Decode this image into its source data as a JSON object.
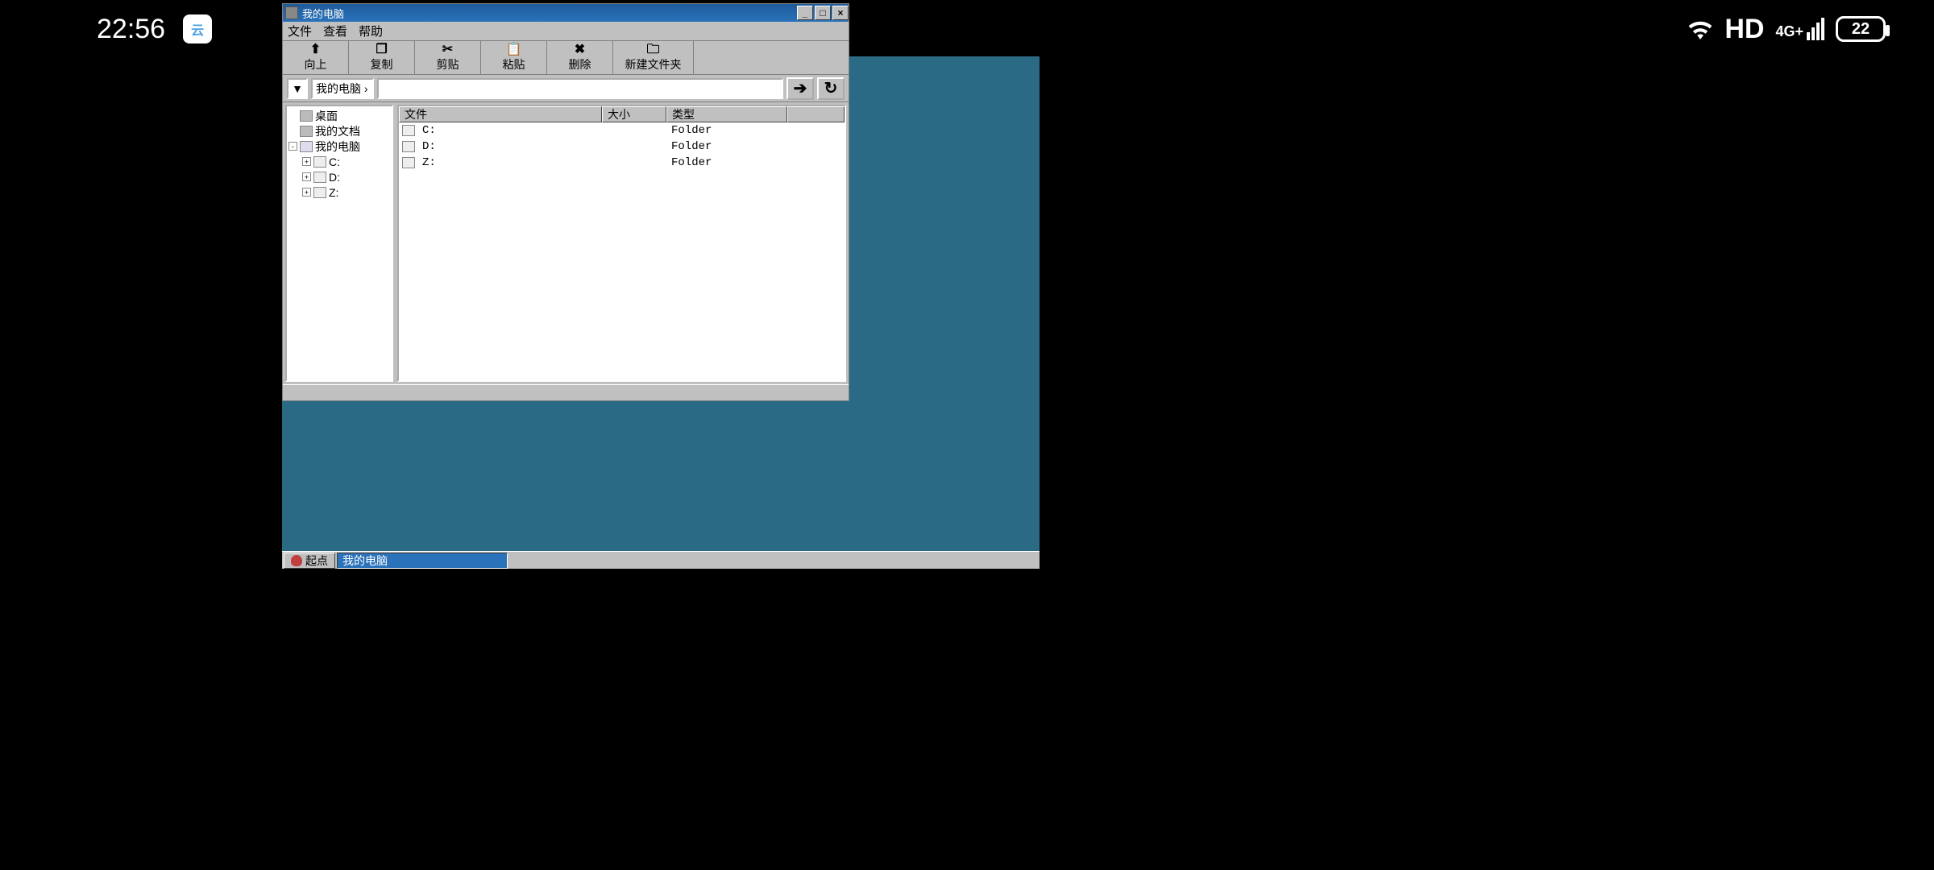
{
  "status": {
    "clock": "22:56",
    "app_badge": "云",
    "hd": "HD",
    "net": "4G+",
    "battery": "22"
  },
  "window": {
    "title": "我的电脑",
    "menus": {
      "file": "文件",
      "view": "查看",
      "help": "帮助"
    },
    "toolbar": {
      "up": "向上",
      "copy": "复制",
      "cut": "剪贴",
      "paste": "粘贴",
      "delete": "删除",
      "newfolder": "新建文件夹"
    },
    "address": {
      "path": "我的电脑 ›"
    },
    "tree": {
      "desktop": "桌面",
      "documents": "我的文档",
      "computer": "我的电脑",
      "drives": [
        "C:",
        "D:",
        "Z:"
      ]
    },
    "list": {
      "headers": {
        "file": "文件",
        "size": "大小",
        "type": "类型"
      },
      "rows": [
        {
          "name": "C:",
          "size": "",
          "type": "Folder"
        },
        {
          "name": "D:",
          "size": "",
          "type": "Folder"
        },
        {
          "name": "Z:",
          "size": "",
          "type": "Folder"
        }
      ]
    }
  },
  "taskbar": {
    "start": "起点",
    "task": "我的电脑"
  }
}
